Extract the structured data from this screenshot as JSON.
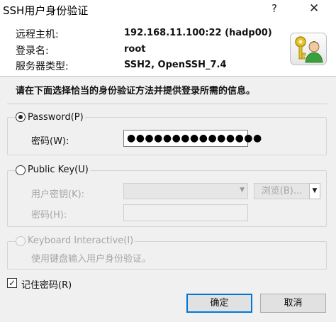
{
  "window": {
    "title": "SSH用户身份验证",
    "help_glyph": "?",
    "close_glyph": "✕"
  },
  "info": {
    "host_label": "远程主机:",
    "host_value": "192.168.11.100:22 (hadp00)",
    "login_label": "登录名:",
    "login_value": "root",
    "server_label": "服务器类型:",
    "server_value": "SSH2, OpenSSH_7.4"
  },
  "instruction": "请在下面选择恰当的身份验证方法并提供登录所需的信息。",
  "password_group": {
    "label": "Password(P)",
    "field_label": "密码(W):",
    "field_value": "●●●●●●●●●●●●●●●"
  },
  "publickey_group": {
    "label": "Public Key(U)",
    "key_label": "用户密钥(K):",
    "browse_label": "浏览(B)...",
    "browse_arrow": "▼",
    "pass_label": "密码(H):"
  },
  "keyboard_group": {
    "label": "Keyboard Interactive(I)",
    "description": "使用键盘输入用户身份验证。"
  },
  "remember": {
    "label": "记住密码(R)",
    "checked_glyph": "✓"
  },
  "buttons": {
    "ok": "确定",
    "cancel": "取消"
  }
}
